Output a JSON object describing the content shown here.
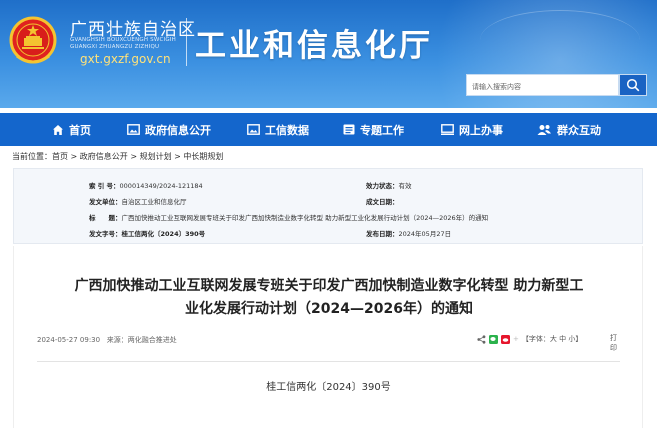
{
  "header": {
    "region_name": "广西壮族自治区",
    "region_pinyin": "GVANGHSIH BOUXCUENGH SWCIGIH GUANGXI ZHUANGZU ZIZHIQU",
    "domain": "gxt.gxzf.gov.cn",
    "dept_title": "工业和信息化厅",
    "search_placeholder": "请输入搜索内容"
  },
  "nav": {
    "items": [
      {
        "label": "首页",
        "icon": "home-icon"
      },
      {
        "label": "政府信息公开",
        "icon": "picture-icon"
      },
      {
        "label": "工信数据",
        "icon": "picture-icon"
      },
      {
        "label": "专题工作",
        "icon": "list-icon"
      },
      {
        "label": "网上办事",
        "icon": "monitor-icon"
      },
      {
        "label": "群众互动",
        "icon": "people-icon"
      }
    ]
  },
  "breadcrumb": {
    "prefix": "当前位置：",
    "items": [
      "首页",
      "政府信息公开",
      "规划计划",
      "中长期规划"
    ],
    "separator": " > "
  },
  "meta": {
    "index_label": "索 引 号：",
    "index_value": "000014349/2024-121184",
    "status_label": "效力状态：",
    "status_value": "有效",
    "issuer_label": "发文单位：",
    "issuer_value": "自治区工业和信息化厅",
    "effective_label": "成文日期：",
    "effective_value": "",
    "title_label": "标　　题：",
    "title_value": "广西加快推动工业互联网发展专班关于印发广西加快制造业数字化转型 助力新型工业化发展行动计划（2024—2026年）的通知",
    "docno_label": "发文字号：",
    "docno_value": "桂工信两化〔2024〕390号",
    "published_label": "发布日期：",
    "published_value": "2024年05月27日"
  },
  "article": {
    "title_line1": "广西加快推动工业互联网发展专班关于印发广西加快制造业数字化转型 助力新型工",
    "title_line2": "业化发展行动计划（2024—2026年）的通知",
    "datetime": "2024-05-27 09:30",
    "source_label": "来源：",
    "source_value": "两化融合推进处",
    "font_label": "【字体：",
    "font_large": "大",
    "font_medium": "中",
    "font_small": "小",
    "font_close": "】",
    "print_label": "打印",
    "doc_number": "桂工信两化〔2024〕390号"
  },
  "colors": {
    "header_blue": "#1f6fc9",
    "nav_blue": "#1466cc",
    "domain_yellow": "#ffe27a",
    "meta_bg": "#f4f7fb"
  }
}
